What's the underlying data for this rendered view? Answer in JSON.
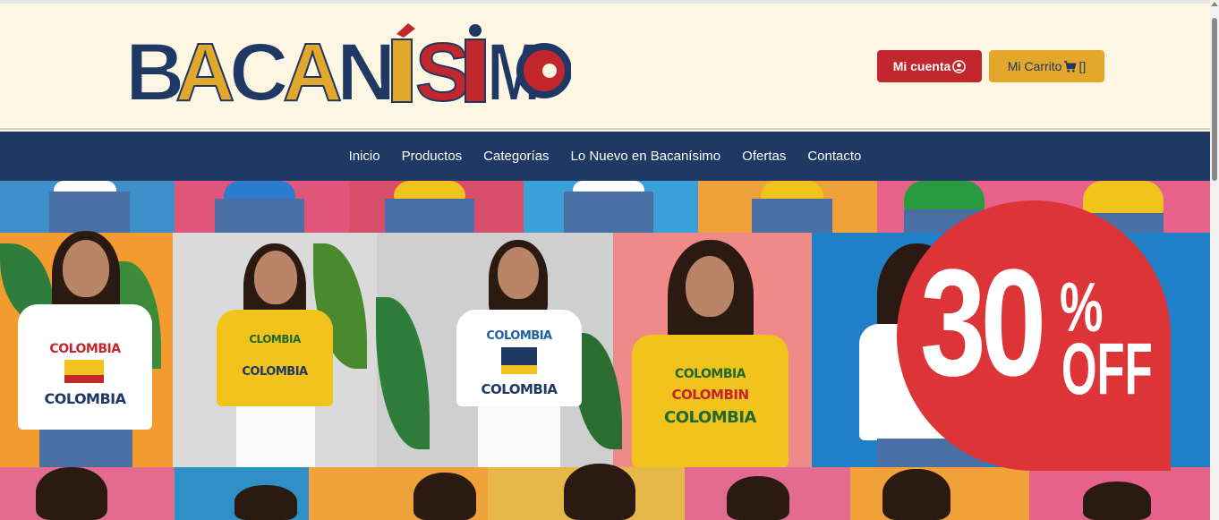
{
  "header": {
    "logo_text": "BACANÍSIMO",
    "account_label": "Mi cuenta",
    "account_icon": "user-circle-icon",
    "cart_label": "Mi Carrito",
    "cart_icon": "shopping-cart-icon",
    "cart_count": "[]"
  },
  "nav": {
    "items": [
      {
        "label": "Inicio"
      },
      {
        "label": "Productos"
      },
      {
        "label": "Categorías"
      },
      {
        "label": "Lo Nuevo en Bacanísimo"
      },
      {
        "label": "Ofertas"
      },
      {
        "label": "Contacto"
      }
    ]
  },
  "hero": {
    "shirt_texts": [
      "COLOMBIA",
      "COLOMBIA",
      "CLOMBIA",
      "COLOMBIA",
      "COLOMBIA",
      "COLOMBIA",
      "COLOMBIA",
      "COLOMBIN",
      "COLOMBIA"
    ],
    "badge_number": "30",
    "badge_percent": "%",
    "badge_off": "OFF"
  },
  "colors": {
    "cream": "#fdf6e3",
    "navy": "#1f3864",
    "red": "#c1272d",
    "yellow": "#e3a82b",
    "badge_red": "#dd3437"
  }
}
